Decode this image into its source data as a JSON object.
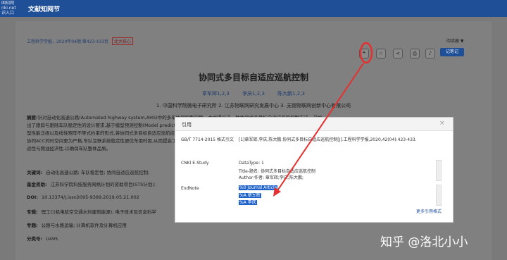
{
  "header": {
    "logo_lines": [
      "国知网",
      "nki.net",
      "识入口"
    ],
    "brand": "文献知网节"
  },
  "article": {
    "source": "工程科学学报，2020年04期 第423-433页",
    "badge": "北大核心",
    "read_mode": "阅读器 ▼",
    "title": "协同式多目标自适应巡航控制",
    "authors": [
      "章军辉1,2,3",
      "李庆1,2,3",
      "陈大鹏1,2,3"
    ],
    "affiliations": "1. 中国科学院微电子研究所  2. 江苏物联网研究发展中心  3. 无锡物联网创新中心有限公司",
    "abstract_label": "摘要:",
    "abstract_lines": [
      "针对自动化高速公路(Automated highway system,AHS)中的多车协同控制问题，本文提出了一种协同式多目标自适应巡航控制方法，开始",
      "出了跟踪与跟随车队稳定性的设计要求,基于模型预测控制(Model predictive control,MPC)框架,考虑车辆纵向运动学特性,建立二次",
      "型性能泛函以及线性矩阵不等式约束的形式,将协同式多目标自适应巡航控制问题转化为带约束的在线滚动优化问题,并给出了相应的求解方法,",
      "协同ACC的时空间更为严格,车队互联系统稳定性更优车用时距,从而提高了道路通行能力,仿真结果表明所提控制方法在保证安全舒",
      "适性与燃油经济性,以确保车队整体品质。"
    ],
    "keywords_label": "关键词:",
    "keywords": "自动化高速公路; 车队稳定性; 协同自适应巡航控制;",
    "fund_label": "基金资助:",
    "fund": "江苏科学院科技服务网络计划的资助项目(STS计划);",
    "doi_label": "DOI:",
    "doi": "10.13374/j.issn2095-9389.2019.05.21.002",
    "topic_label": "专辑:",
    "topic": "理工C(机电航空交通水利建筑能源); 电子技术及信息科学",
    "subject_label": "专题:",
    "subject": "公路与水路运输; 计算机软件及计算机应用",
    "class_label": "分类号:",
    "class": "U495"
  },
  "toolbar": {
    "icons": [
      {
        "name": "quote-icon",
        "glyph": "❝"
      },
      {
        "name": "favorite-icon",
        "glyph": "☆"
      },
      {
        "name": "share-icon",
        "glyph": "<"
      },
      {
        "name": "print-icon",
        "glyph": "⎙"
      },
      {
        "name": "bell-icon",
        "glyph": "♪"
      }
    ],
    "note_label": "记笔记"
  },
  "modal": {
    "title": "引用",
    "close": "×",
    "gbt_label": "GB/T 7714-2015 格式引文",
    "gbt_text": "[1]章军辉,李庆,陈大鹏.协同式多目标自适应巡航控制[J].工程科学学报,2020,42(04):423-433.",
    "estudy_label": "CNKI E-Study",
    "estudy_lines": [
      "DataType: 1",
      "Title-题名: 协同式多目标自适应巡航控制",
      "Author-作者: 章军辉;李庆;陈大鹏;"
    ],
    "endnote_label": "EndNote",
    "endnote_lines": [
      "%0 Journal Article",
      "%A 章军辉",
      "%A 李庆"
    ],
    "more": "更多引用格式"
  },
  "watermark": "知乎 @洛北小小",
  "colors": {
    "header_bg": "#1f4f96",
    "arrow": "#e53030",
    "highlight": "#1e62c9"
  }
}
